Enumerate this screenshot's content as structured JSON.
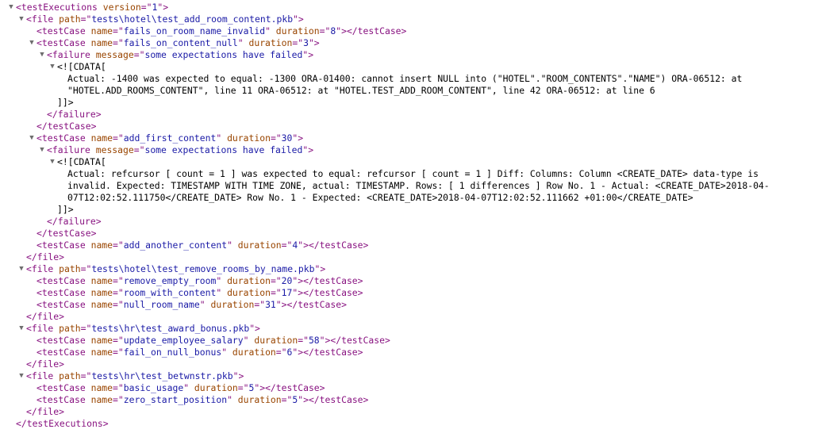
{
  "root": {
    "tag": "testExecutions",
    "attrs": [
      {
        "name": "version",
        "value": "1"
      }
    ],
    "files": [
      {
        "path": "tests\\hotel\\test_add_room_content.pkb",
        "testCases": [
          {
            "name": "fails_on_room_name_invalid",
            "duration": "8"
          },
          {
            "name": "fails_on_content_null",
            "duration": "3",
            "failure": {
              "message": "some expectations have failed",
              "cdata_open": "<![CDATA[",
              "cdata_lines": [
                "Actual: -1400 was expected to equal: -1300 ORA-01400: cannot insert NULL into (\"HOTEL\".\"ROOM_CONTENTS\".\"NAME\") ORA-06512: at",
                "\"HOTEL.ADD_ROOMS_CONTENT\", line 11 ORA-06512: at \"HOTEL.TEST_ADD_ROOM_CONTENT\", line 42 ORA-06512: at line 6"
              ],
              "cdata_close": "]]>"
            }
          },
          {
            "name": "add_first_content",
            "duration": "30",
            "failure": {
              "message": "some expectations have failed",
              "cdata_open": "<![CDATA[",
              "cdata_lines": [
                "Actual: refcursor [ count = 1 ] was expected to equal: refcursor [ count = 1 ] Diff: Columns: Column <CREATE_DATE> data-type is",
                "invalid. Expected: TIMESTAMP WITH TIME ZONE, actual: TIMESTAMP. Rows: [ 1 differences ] Row No. 1 - Actual: <CREATE_DATE>2018-04-",
                "07T12:02:52.111750</CREATE_DATE> Row No. 1 - Expected: <CREATE_DATE>2018-04-07T12:02:52.111662 +01:00</CREATE_DATE>"
              ],
              "cdata_close": "]]>"
            }
          },
          {
            "name": "add_another_content",
            "duration": "4"
          }
        ]
      },
      {
        "path": "tests\\hotel\\test_remove_rooms_by_name.pkb",
        "testCases": [
          {
            "name": "remove_empty_room",
            "duration": "20"
          },
          {
            "name": "room_with_content",
            "duration": "17"
          },
          {
            "name": "null_room_name",
            "duration": "31"
          }
        ]
      },
      {
        "path": "tests\\hr\\test_award_bonus.pkb",
        "testCases": [
          {
            "name": "update_employee_salary",
            "duration": "58"
          },
          {
            "name": "fail_on_null_bonus",
            "duration": "6"
          }
        ]
      },
      {
        "path": "tests\\hr\\test_betwnstr.pkb",
        "testCases": [
          {
            "name": "basic_usage",
            "duration": "5"
          },
          {
            "name": "zero_start_position",
            "duration": "5"
          }
        ]
      }
    ]
  },
  "labels": {
    "file_tag": "file",
    "path_attr": "path",
    "testcase_tag": "testCase",
    "name_attr": "name",
    "duration_attr": "duration",
    "failure_tag": "failure",
    "message_attr": "message"
  },
  "icons": {
    "expand": "expanded-triangle-icon"
  },
  "colors": {
    "tag": "#881280",
    "attr_name": "#994500",
    "attr_value": "#1a1aa6",
    "text": "#000000",
    "triangle": "#6e6e6e"
  }
}
